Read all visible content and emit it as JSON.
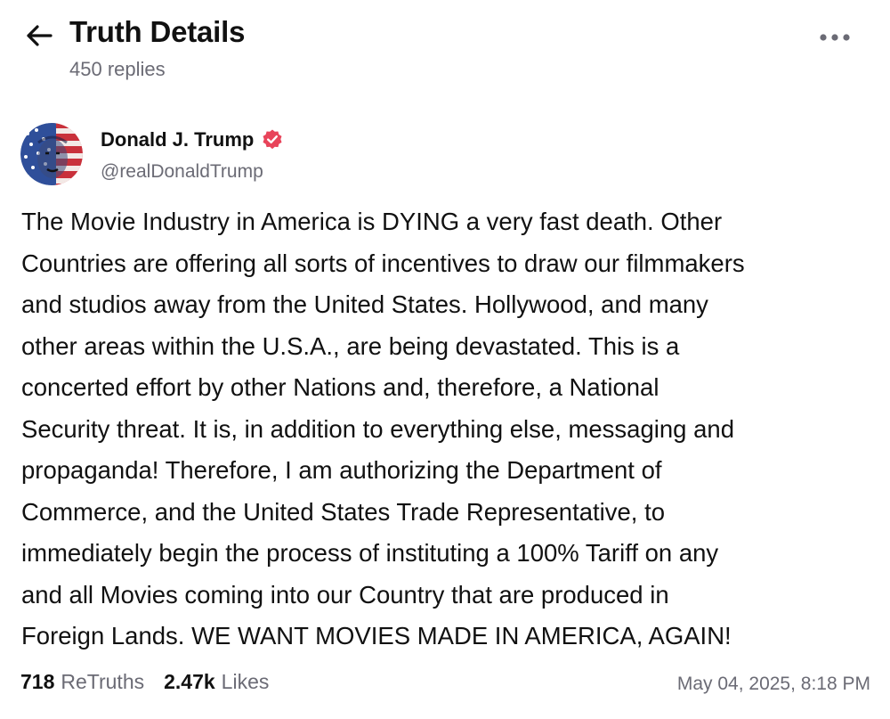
{
  "header": {
    "title": "Truth Details",
    "replies": "450 replies",
    "back_icon": "arrow-left-icon",
    "more_icon": "more-horizontal-icon"
  },
  "author": {
    "name": "Donald J. Trump",
    "handle": "@realDonaldTrump",
    "verified_icon": "verified-badge-icon",
    "verified_color": "#e8445a"
  },
  "post": {
    "lines": [
      "The Movie Industry in America is DYING a very fast death. Other",
      "Countries are offering all sorts of incentives to draw our filmmakers",
      "and studios away from the United States. Hollywood, and many",
      "other areas within the U.S.A., are being devastated. This is a",
      "concerted effort by other Nations and, therefore, a National",
      "Security threat. It is, in addition to everything else, messaging and",
      "propaganda! Therefore, I am authorizing the Department of",
      "Commerce, and the United States Trade Representative, to",
      "immediately begin the process of instituting a 100% Tariff on any",
      "and all Movies coming into our Country that are produced in",
      "Foreign Lands. WE WANT MOVIES MADE IN AMERICA, AGAIN!"
    ]
  },
  "stats": {
    "retruths_count": "718",
    "retruths_label": "ReTruths",
    "likes_count": "2.47k",
    "likes_label": "Likes",
    "timestamp": "May 04, 2025, 8:18 PM"
  },
  "colors": {
    "text_primary": "#111111",
    "text_secondary": "#6b6b75",
    "background": "#ffffff"
  }
}
